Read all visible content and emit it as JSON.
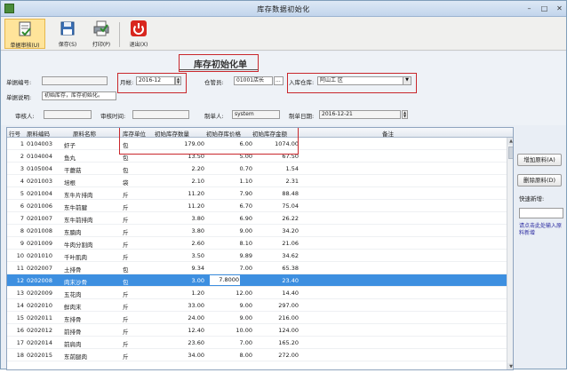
{
  "window": {
    "title": "库存数据初始化"
  },
  "titlebar": {
    "minimize": "–",
    "maximize": "□",
    "close": "✕"
  },
  "toolbar": {
    "audit_label": "单据审核(U)",
    "save_label": "保存(S)",
    "print_label": "打印(P)",
    "exit_label": "退出(X)"
  },
  "form": {
    "title": "库存初始化单",
    "doc_no_label": "单据编号:",
    "doc_no_value": "",
    "period_label": "月帐:",
    "period_value": "2016-12",
    "keeper_label": "仓管员:",
    "keeper_value": "01001店长",
    "keeper_more": "...",
    "warehouse_label": "入库仓库:",
    "warehouse_value": "阿山工 区",
    "note_label": "单据说明:",
    "note_value": "初始库存，库存初始化。",
    "auditor_label": "审核人:",
    "auditor_value": "",
    "audit_time_label": "审核时间:",
    "audit_time_value": "",
    "maker_label": "制单人:",
    "maker_value": "system",
    "make_date_label": "制单日期:",
    "make_date_value": "2016-12-21"
  },
  "grid": {
    "headers": {
      "no": "行号",
      "code": "原料编码",
      "name": "原料名称",
      "unit": "库存单位",
      "qty": "初始库存数量",
      "price": "初始存库价格",
      "amount": "初始库存金额",
      "remark": "备注"
    },
    "selected_index": 11,
    "rows": [
      {
        "no": "1",
        "code": "0104003",
        "name": "虾子",
        "unit": "包",
        "qty": "179.00",
        "price": "6.00",
        "amount": "1074.00"
      },
      {
        "no": "2",
        "code": "0104004",
        "name": "鱼丸",
        "unit": "包",
        "qty": "13.50",
        "price": "5.00",
        "amount": "67.50"
      },
      {
        "no": "3",
        "code": "0105004",
        "name": "干蘑菇",
        "unit": "包",
        "qty": "2.20",
        "price": "0.70",
        "amount": "1.54"
      },
      {
        "no": "4",
        "code": "0201003",
        "name": "培根",
        "unit": "袋",
        "qty": "2.10",
        "price": "1.10",
        "amount": "2.31"
      },
      {
        "no": "5",
        "code": "0201004",
        "name": "东牛片排肉",
        "unit": "斤",
        "qty": "11.20",
        "price": "7.90",
        "amount": "88.48"
      },
      {
        "no": "6",
        "code": "0201006",
        "name": "东牛前腱",
        "unit": "斤",
        "qty": "11.20",
        "price": "6.70",
        "amount": "75.04"
      },
      {
        "no": "7",
        "code": "0201007",
        "name": "东牛前排肉",
        "unit": "斤",
        "qty": "3.80",
        "price": "6.90",
        "amount": "26.22"
      },
      {
        "no": "8",
        "code": "0201008",
        "name": "东腩肉",
        "unit": "斤",
        "qty": "3.80",
        "price": "9.00",
        "amount": "34.20"
      },
      {
        "no": "9",
        "code": "0201009",
        "name": "牛肉分割肉",
        "unit": "斤",
        "qty": "2.60",
        "price": "8.10",
        "amount": "21.06"
      },
      {
        "no": "10",
        "code": "0201010",
        "name": "千叶肌肉",
        "unit": "斤",
        "qty": "3.50",
        "price": "9.89",
        "amount": "34.62"
      },
      {
        "no": "11",
        "code": "0202007",
        "name": "土排骨",
        "unit": "包",
        "qty": "9.34",
        "price": "7.00",
        "amount": "65.38"
      },
      {
        "no": "12",
        "code": "0202008",
        "name": "肉末沙骨",
        "unit": "包",
        "qty": "3.00",
        "price": "7.8000",
        "amount": "23.40"
      },
      {
        "no": "13",
        "code": "0202009",
        "name": "五花肉",
        "unit": "斤",
        "qty": "1.20",
        "price": "12.00",
        "amount": "14.40"
      },
      {
        "no": "14",
        "code": "0202010",
        "name": "鲜肉末",
        "unit": "斤",
        "qty": "33.00",
        "price": "9.00",
        "amount": "297.00"
      },
      {
        "no": "15",
        "code": "0202011",
        "name": "东排骨",
        "unit": "斤",
        "qty": "24.00",
        "price": "9.00",
        "amount": "216.00"
      },
      {
        "no": "16",
        "code": "0202012",
        "name": "前排骨",
        "unit": "斤",
        "qty": "12.40",
        "price": "10.00",
        "amount": "124.00"
      },
      {
        "no": "17",
        "code": "0202014",
        "name": "前肩肉",
        "unit": "斤",
        "qty": "23.60",
        "price": "7.00",
        "amount": "165.20"
      },
      {
        "no": "18",
        "code": "0202015",
        "name": "东前腿肉",
        "unit": "斤",
        "qty": "34.00",
        "price": "8.00",
        "amount": "272.00"
      }
    ]
  },
  "side": {
    "add_button": "增加原料(A)",
    "delete_button": "删除原料(D)",
    "quick_add_label": "快速新增:",
    "quick_add_value": "",
    "hint": "请点击此处输入原料新增"
  },
  "colors": {
    "highlight": "#c9272c",
    "selection": "#3d8fe0",
    "exit_icon": "#d8261e"
  }
}
